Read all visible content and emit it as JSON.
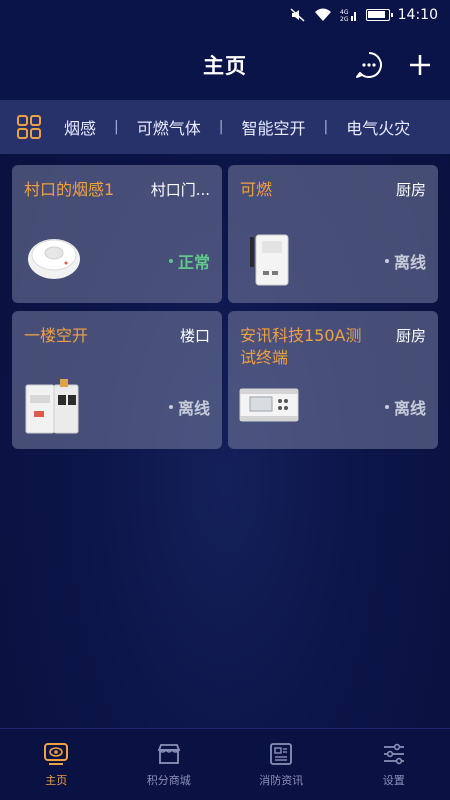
{
  "status_bar": {
    "time": "14:10",
    "network": "4G 2G"
  },
  "header": {
    "title": "主页"
  },
  "categories": [
    "烟感",
    "可燃气体",
    "智能空开",
    "电气火灾"
  ],
  "devices": [
    {
      "name": "村口的烟感1",
      "location": "村口门...",
      "status": "正常",
      "state": "online",
      "icon": "smoke-detector-icon"
    },
    {
      "name": "可燃",
      "location": "厨房",
      "status": "离线",
      "state": "offline",
      "icon": "gas-detector-icon"
    },
    {
      "name": "一楼空开",
      "location": "楼口",
      "status": "离线",
      "state": "offline",
      "icon": "circuit-breaker-icon"
    },
    {
      "name": "安讯科技150A测试终端",
      "location": "厨房",
      "status": "离线",
      "state": "offline",
      "icon": "test-terminal-icon"
    }
  ],
  "bottom_nav": [
    {
      "label": "主页",
      "active": true,
      "icon": "home-eye-icon"
    },
    {
      "label": "积分商城",
      "active": false,
      "icon": "store-icon"
    },
    {
      "label": "消防资讯",
      "active": false,
      "icon": "news-icon"
    },
    {
      "label": "设置",
      "active": false,
      "icon": "settings-sliders-icon"
    }
  ],
  "colors": {
    "accent": "#f0a13f",
    "online": "#5fc98a",
    "background": "#0c1548"
  }
}
